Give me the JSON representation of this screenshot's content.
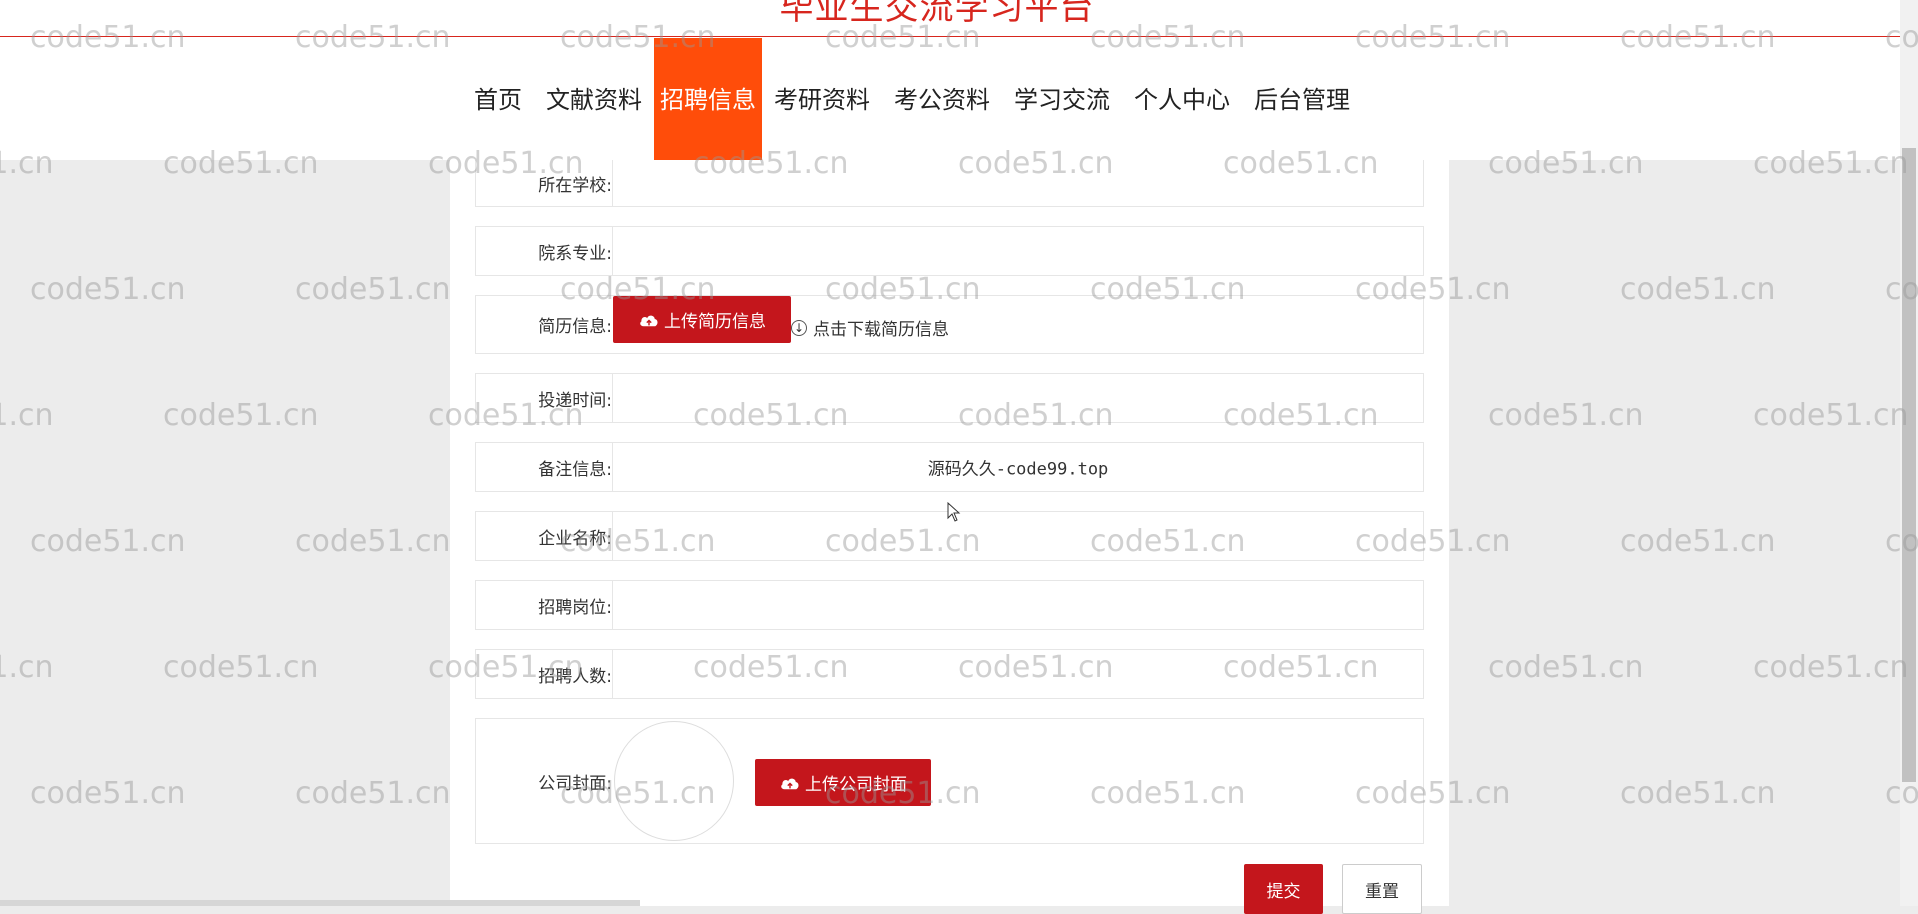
{
  "header": {
    "site_title": "毕业生交流学习平台",
    "nav": [
      {
        "label": "首页",
        "active": false
      },
      {
        "label": "文献资料",
        "active": false
      },
      {
        "label": "招聘信息",
        "active": true
      },
      {
        "label": "考研资料",
        "active": false
      },
      {
        "label": "考公资料",
        "active": false
      },
      {
        "label": "学习交流",
        "active": false
      },
      {
        "label": "个人中心",
        "active": false
      },
      {
        "label": "后台管理",
        "active": false
      }
    ],
    "accent_color": "#ff4d0a",
    "title_color": "#d7261e"
  },
  "form": {
    "fields": [
      {
        "label": "所在学校:",
        "value": ""
      },
      {
        "label": "院系专业:",
        "value": ""
      },
      {
        "label": "简历信息:",
        "value": ""
      },
      {
        "label": "投递时间:",
        "value": ""
      },
      {
        "label": "备注信息:",
        "value": "源码久久-code99.top"
      },
      {
        "label": "企业名称:",
        "value": ""
      },
      {
        "label": "招聘岗位:",
        "value": ""
      },
      {
        "label": "招聘人数:",
        "value": ""
      },
      {
        "label": "公司封面:",
        "value": ""
      }
    ],
    "upload_resume_label": "上传简历信息",
    "download_resume_label": "点击下载简历信息",
    "upload_cover_label": "上传公司封面",
    "submit_label": "提交",
    "reset_label": "重置",
    "button_color": "#c4161c"
  },
  "watermark": "code51.cn"
}
